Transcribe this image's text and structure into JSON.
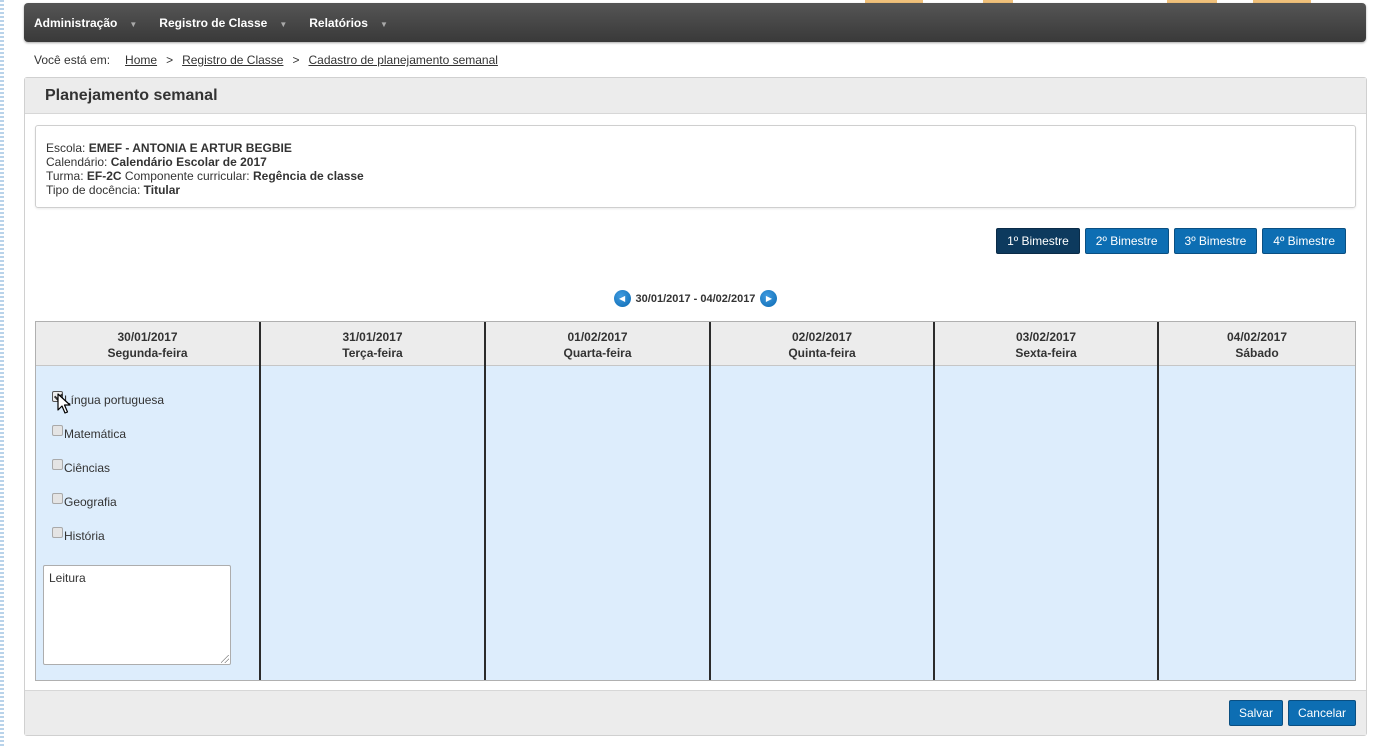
{
  "nav": {
    "items": [
      {
        "label": "Administração"
      },
      {
        "label": "Registro de Classe"
      },
      {
        "label": "Relatórios"
      }
    ],
    "caret": "▼"
  },
  "breadcrumb": {
    "prefix": "Você está em:",
    "separator": ">",
    "items": [
      "Home",
      "Registro de Classe",
      "Cadastro de planejamento semanal"
    ]
  },
  "page": {
    "title": "Planejamento semanal"
  },
  "info": {
    "escola_label": "Escola:",
    "escola": "EMEF - ANTONIA E ARTUR BEGBIE",
    "calendario_label": "Calendário:",
    "calendario": "Calendário Escolar de 2017",
    "turma_label": "Turma:",
    "turma": "EF-2C",
    "componente_label": "Componente curricular:",
    "componente": "Regência de classe",
    "docencia_label": "Tipo de docência:",
    "docencia": "Titular"
  },
  "bimestres": [
    {
      "label": "1º Bimestre",
      "active": true
    },
    {
      "label": "2º Bimestre",
      "active": false
    },
    {
      "label": "3º Bimestre",
      "active": false
    },
    {
      "label": "4º Bimestre",
      "active": false
    }
  ],
  "week": {
    "range": "30/01/2017 - 04/02/2017"
  },
  "days": [
    {
      "date": "30/01/2017",
      "name": "Segunda-feira"
    },
    {
      "date": "31/01/2017",
      "name": "Terça-feira"
    },
    {
      "date": "01/02/2017",
      "name": "Quarta-feira"
    },
    {
      "date": "02/02/2017",
      "name": "Quinta-feira"
    },
    {
      "date": "03/02/2017",
      "name": "Sexta-feira"
    },
    {
      "date": "04/02/2017",
      "name": "Sábado"
    }
  ],
  "subjects": [
    {
      "label": "Língua portuguesa",
      "checked": true
    },
    {
      "label": "Matemática",
      "checked": false
    },
    {
      "label": "Ciências",
      "checked": false
    },
    {
      "label": "Geografia",
      "checked": false
    },
    {
      "label": "História",
      "checked": false
    }
  ],
  "notes": {
    "value": "Leitura"
  },
  "actions": {
    "save": "Salvar",
    "cancel": "Cancelar"
  },
  "colors": {
    "primary": "#0d6eb3",
    "active": "#0d3a5e",
    "cell_bg": "#ddedfc",
    "nav_bg": "#444444"
  }
}
